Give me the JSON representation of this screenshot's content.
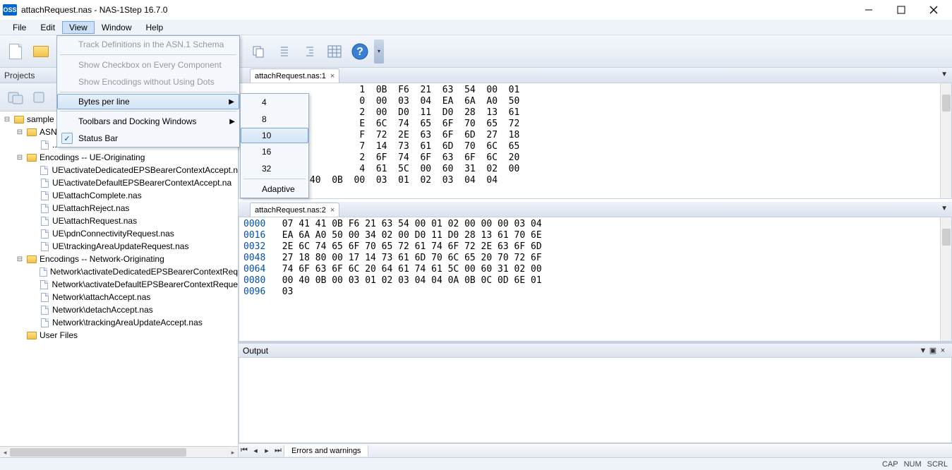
{
  "window": {
    "title": "attachRequest.nas - NAS-1Step 16.7.0",
    "icon_text": "OSS"
  },
  "menus": {
    "file": "File",
    "edit": "Edit",
    "view": "View",
    "window": "Window",
    "help": "Help"
  },
  "view_menu": {
    "track": "Track Definitions in the ASN.1 Schema",
    "checkbox": "Show Checkbox on Every Component",
    "dots": "Show Encodings without Using Dots",
    "bytes": "Bytes per line",
    "toolbars": "Toolbars and Docking Windows",
    "statusbar": "Status Bar"
  },
  "bytes_menu": {
    "b4": "4",
    "b8": "8",
    "b10": "10",
    "b16": "16",
    "b32": "32",
    "adaptive": "Adaptive"
  },
  "projects": {
    "title": "Projects",
    "root": "sample",
    "asn_folder": "ASN",
    "asn_file": "..\\..\\bin\\NAS1670.asn",
    "enc_ue": "Encodings -- UE-Originating",
    "ue_files": [
      "UE\\activateDedicatedEPSBearerContextAccept.n",
      "UE\\activateDefaultEPSBearerContextAccept.na",
      "UE\\attachComplete.nas",
      "UE\\attachReject.nas",
      "UE\\attachRequest.nas",
      "UE\\pdnConnectivityRequest.nas",
      "UE\\trackingAreaUpdateRequest.nas"
    ],
    "enc_net": "Encodings -- Network-Originating",
    "net_files": [
      "Network\\activateDedicatedEPSBearerContextReq",
      "Network\\activateDefaultEPSBearerContextReque",
      "Network\\attachAccept.nas",
      "Network\\detachAccept.nas",
      "Network\\trackingAreaUpdateAccept.nas"
    ],
    "user_files": "User Files"
  },
  "editor1": {
    "tab": "attachRequest.nas:1",
    "lines": [
      "                     1  0B  F6  21  63  54  00  01",
      "                     0  00  03  04  EA  6A  A0  50",
      "                     2  00  D0  11  D0  28  13  61",
      "                     E  6C  74  65  6F  70  65  72",
      "                     F  72  2E  63  6F  6D  27  18",
      "                     7  14  73  61  6D  70  6C  65",
      "                     2  6F  74  6F  63  6F  6C  20",
      "                     4  61  5C  00  60  31  02  00",
      "0080    00  40  0B  00  03  01  02  03  04  04"
    ]
  },
  "editor2": {
    "tab": "attachRequest.nas:2",
    "rows": [
      {
        "addr": "0000",
        "bytes": "07 41 41 0B F6 21 63 54 00 01 02 00 00 00 03 04"
      },
      {
        "addr": "0016",
        "bytes": "EA 6A A0 50 00 34 02 00 D0 11 D0 28 13 61 70 6E"
      },
      {
        "addr": "0032",
        "bytes": "2E 6C 74 65 6F 70 65 72 61 74 6F 72 2E 63 6F 6D"
      },
      {
        "addr": "0048",
        "bytes": "27 18 80 00 17 14 73 61 6D 70 6C 65 20 70 72 6F"
      },
      {
        "addr": "0064",
        "bytes": "74 6F 63 6F 6C 20 64 61 74 61 5C 00 60 31 02 00"
      },
      {
        "addr": "0080",
        "bytes": "00 40 0B 00 03 01 02 03 04 04 0A 0B 0C 0D 6E 01"
      },
      {
        "addr": "0096",
        "bytes": "03"
      }
    ]
  },
  "output": {
    "title": "Output",
    "tab": "Errors and warnings"
  },
  "status": {
    "cap": "CAP",
    "num": "NUM",
    "scrl": "SCRL"
  }
}
